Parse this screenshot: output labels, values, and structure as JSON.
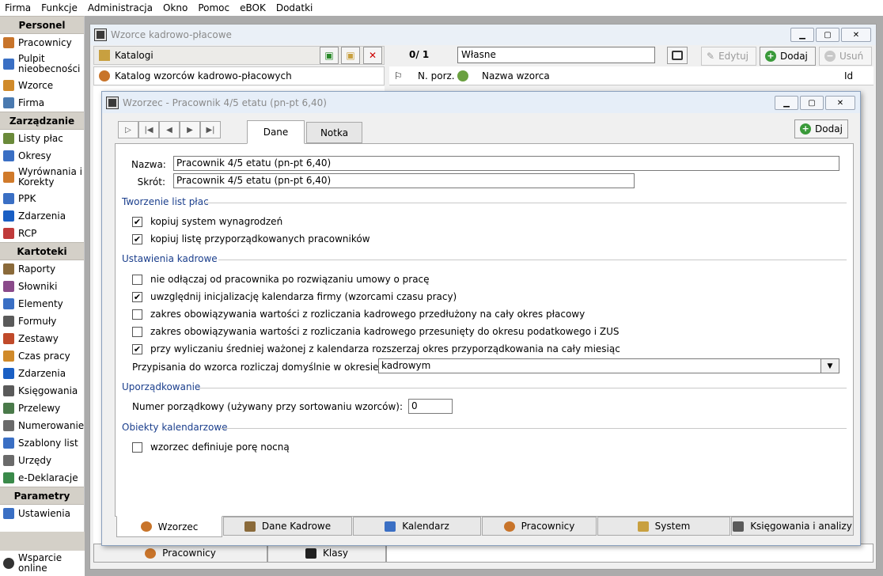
{
  "menu": [
    "Firma",
    "Funkcje",
    "Administracja",
    "Okno",
    "Pomoc",
    "eBOK",
    "Dodatki"
  ],
  "nav": {
    "sections": [
      {
        "title": "Personel",
        "items": [
          {
            "label": "Pracownicy",
            "icon": "people-icon",
            "color": "#c8742a"
          },
          {
            "label": "Pulpit nieobecności",
            "icon": "calendar-icon",
            "color": "#3a6fc4",
            "tall": true
          },
          {
            "label": "Wzorce",
            "icon": "template-icon",
            "color": "#d08a2a"
          },
          {
            "label": "Firma",
            "icon": "building-icon",
            "color": "#4a7ab0"
          }
        ]
      },
      {
        "title": "Zarządzanie",
        "items": [
          {
            "label": "Listy płac",
            "icon": "payroll-icon",
            "color": "#6a8a3a"
          },
          {
            "label": "Okresy",
            "icon": "periods-icon",
            "color": "#3a6fc4"
          },
          {
            "label": "Wyrównania i Korekty",
            "icon": "arrow-icon",
            "color": "#d07a2a",
            "tall": true
          },
          {
            "label": "PPK",
            "icon": "chart-icon",
            "color": "#3a6fc4"
          },
          {
            "label": "Zdarzenia",
            "icon": "info-icon",
            "color": "#1a5fc4"
          },
          {
            "label": "RCP",
            "icon": "clock-icon",
            "color": "#c03a3a"
          }
        ]
      },
      {
        "title": "Kartoteki",
        "items": [
          {
            "label": "Raporty",
            "icon": "report-icon",
            "color": "#8a6a3a"
          },
          {
            "label": "Słowniki",
            "icon": "dictionary-icon",
            "color": "#8a4a8a"
          },
          {
            "label": "Elementy",
            "icon": "elements-icon",
            "color": "#3a6fc4"
          },
          {
            "label": "Formuły",
            "icon": "formula-icon",
            "color": "#5a5a5a"
          },
          {
            "label": "Zestawy",
            "icon": "set-icon",
            "color": "#c04a2a"
          },
          {
            "label": "Czas pracy",
            "icon": "alarm-clock-icon",
            "color": "#d08a2a"
          },
          {
            "label": "Zdarzenia",
            "icon": "info-icon",
            "color": "#1a5fc4"
          },
          {
            "label": "Księgowania",
            "icon": "ledger-icon",
            "color": "#5a5a5a"
          },
          {
            "label": "Przelewy",
            "icon": "transfer-icon",
            "color": "#4a7a4a"
          },
          {
            "label": "Numerowanie",
            "icon": "numbering-icon",
            "color": "#6a6a6a"
          },
          {
            "label": "Szablony list",
            "icon": "list-template-icon",
            "color": "#3a6fc4"
          },
          {
            "label": "Urzędy",
            "icon": "office-icon",
            "color": "#6a6a6a"
          },
          {
            "label": "e-Deklaracje",
            "icon": "edeclaration-icon",
            "color": "#3a8a4a"
          }
        ]
      },
      {
        "title": "Parametry",
        "items": [
          {
            "label": "Ustawienia",
            "icon": "tools-icon",
            "color": "#3a6fc4"
          }
        ]
      }
    ],
    "support": {
      "label": "Wsparcie online",
      "icon": "phone-icon"
    }
  },
  "bgwin": {
    "title": "Wzorce kadrowo-płacowe",
    "katalogi_label": "Katalogi",
    "tree_root": "Katalog wzorców kadrowo-płacowych",
    "counter": "0/ 1",
    "filter_value": "Własne",
    "edit_label": "Edytuj",
    "add_label": "Dodaj",
    "remove_label": "Usuń",
    "col_nporz": "N. porz.",
    "col_name": "Nazwa wzorca",
    "col_id": "Id",
    "bottom_tabs": [
      "Pracownicy",
      "Klasy"
    ]
  },
  "dialog": {
    "title": "Wzorzec - Pracownik 4/5 etatu (pn-pt 6,40)",
    "tabs": [
      "Dane",
      "Notka"
    ],
    "add_label": "Dodaj",
    "name_label": "Nazwa:",
    "name_value": "Pracownik 4/5 etatu (pn-pt 6,40)",
    "short_label": "Skrót:",
    "short_value": "Pracownik 4/5 etatu (pn-pt 6,40)",
    "group1": "Tworzenie list płac",
    "chk1": "kopiuj system wynagrodzeń",
    "chk2": "kopiuj listę przyporządkowanych pracowników",
    "group2": "Ustawienia kadrowe",
    "chk3": "nie odłączaj od pracownika po rozwiązaniu umowy o pracę",
    "chk4": "uwzględnij inicjalizację kalendarza firmy (wzorcami czasu pracy)",
    "chk5": "zakres obowiązywania wartości z rozliczania kadrowego przedłużony na cały okres płacowy",
    "chk6": "zakres obowiązywania wartości z rozliczania kadrowego przesunięty do okresu podatkowego i ZUS",
    "chk7": "przy wyliczaniu średniej ważonej z kalendarza rozszerzaj okres przyporządkowania na cały miesiąc",
    "period_label": "Przypisania do wzorca rozliczaj domyślnie w okresie:",
    "period_value": "kadrowym",
    "group3": "Uporządkowanie",
    "order_label": "Numer porządkowy (używany przy sortowaniu wzorców):",
    "order_value": "0",
    "group4": "Obiekty kalendarzowe",
    "chk8": "wzorzec definiuje porę nocną",
    "bottom_tabs": [
      "Wzorzec",
      "Dane Kadrowe",
      "Kalendarz",
      "Pracownicy",
      "System",
      "Księgowania i analizy"
    ]
  }
}
